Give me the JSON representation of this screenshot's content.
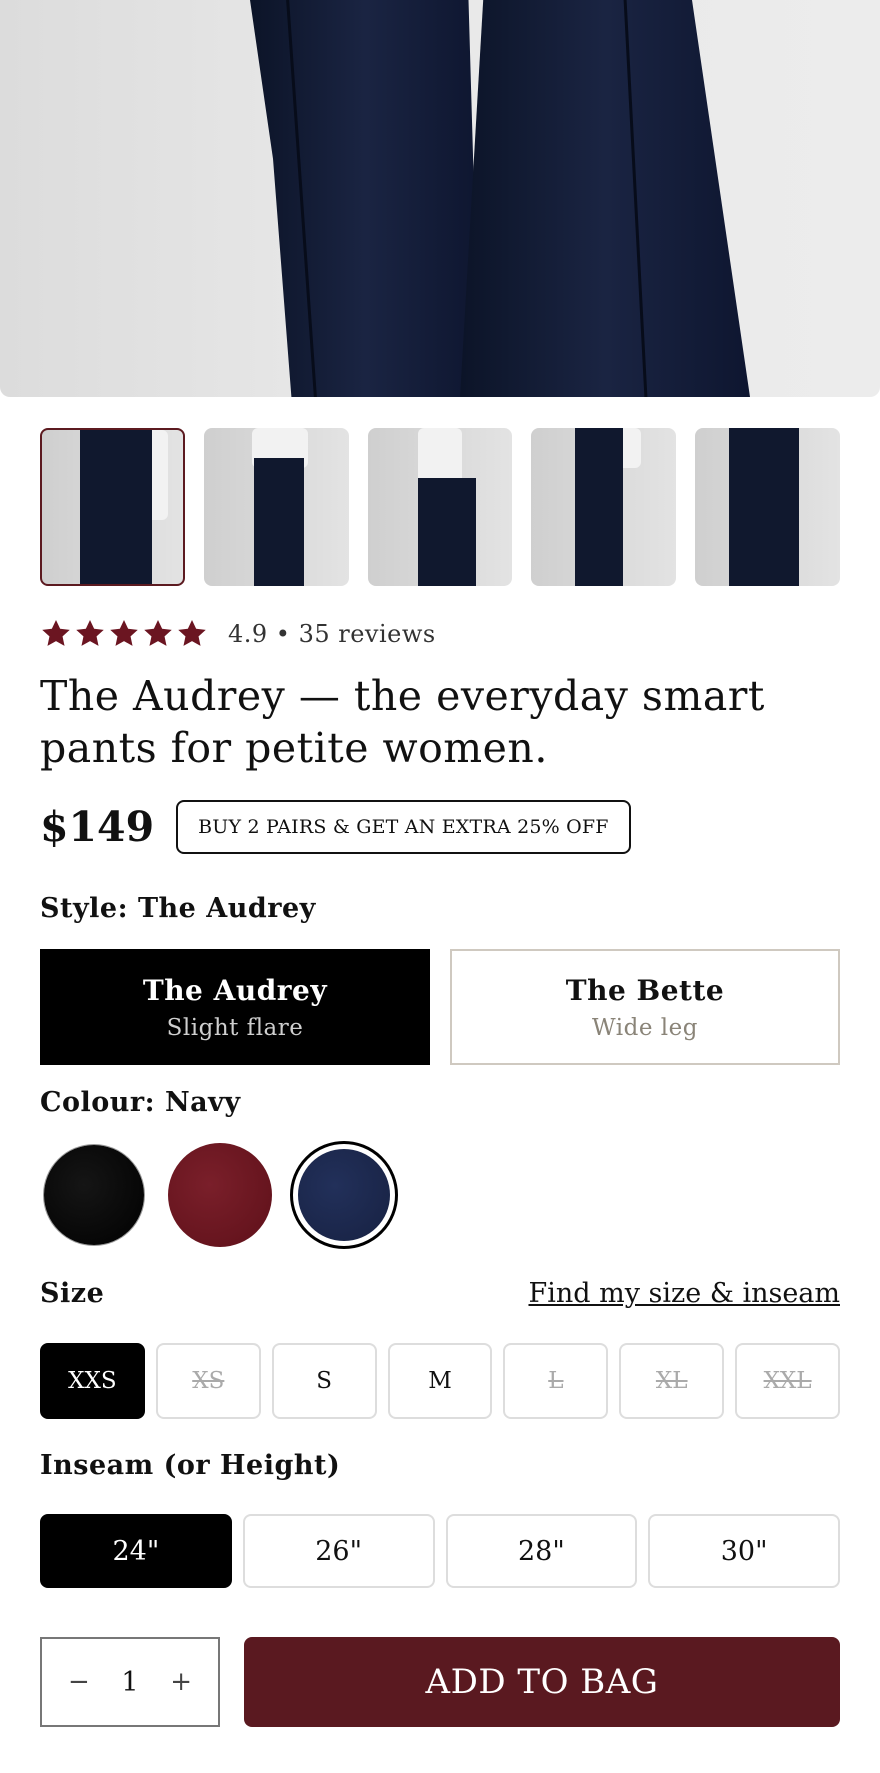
{
  "product": {
    "rating_value": 4.9,
    "rating_text": "4.9 • 35 reviews",
    "title": "The Audrey — the everyday smart pants for petite women.",
    "price": "$149",
    "promo": "BUY 2 PAIRS & GET AN EXTRA 25% OFF"
  },
  "style": {
    "label": "Style: The Audrey",
    "options": [
      {
        "name": "The Audrey",
        "sub": "Slight flare",
        "selected": true
      },
      {
        "name": "The Bette",
        "sub": "Wide leg",
        "selected": false
      }
    ]
  },
  "colour": {
    "label": "Colour: Navy",
    "options": [
      {
        "name": "black",
        "hex": "#000000"
      },
      {
        "name": "wine",
        "hex": "#6b1521"
      },
      {
        "name": "navy",
        "hex": "#1b2648",
        "selected": true
      }
    ]
  },
  "size": {
    "label": "Size",
    "link": "Find my size & inseam",
    "options": [
      {
        "label": "XXS",
        "state": "selected"
      },
      {
        "label": "XS",
        "state": "unavailable"
      },
      {
        "label": "S",
        "state": "available"
      },
      {
        "label": "M",
        "state": "available"
      },
      {
        "label": "L",
        "state": "unavailable"
      },
      {
        "label": "XL",
        "state": "unavailable"
      },
      {
        "label": "XXL",
        "state": "unavailable"
      }
    ]
  },
  "inseam": {
    "label": "Inseam (or Height)",
    "options": [
      "24\"",
      "26\"",
      "28\"",
      "30\""
    ],
    "selected": "24\""
  },
  "cart": {
    "minus": "−",
    "quantity": "1",
    "plus": "+",
    "add_label": "ADD TO BAG"
  },
  "colors": {
    "accent": "#5a1920",
    "star": "#6b1521"
  }
}
